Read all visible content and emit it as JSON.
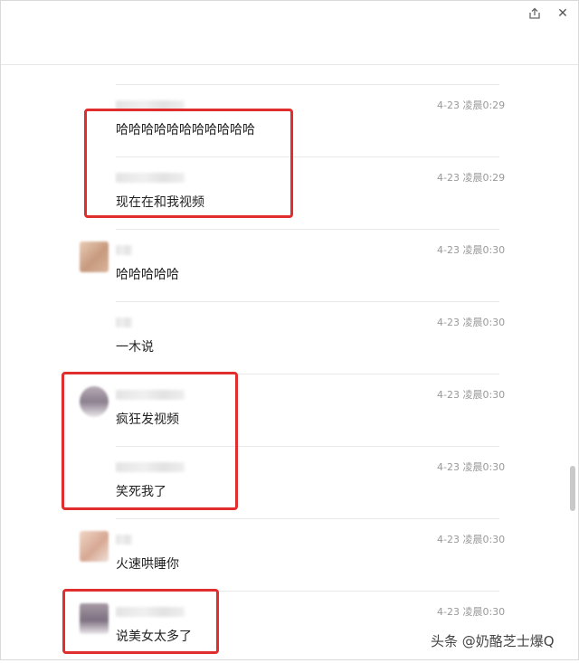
{
  "window": {
    "share_icon": "share-icon",
    "close_icon": "close-icon",
    "close_glyph": "✕"
  },
  "messages": [
    {
      "time": "4-23 凌晨0:29",
      "text": "哈哈哈哈哈哈哈哈哈哈哈",
      "avatar": false
    },
    {
      "time": "4-23 凌晨0:29",
      "text": "现在在和我视频",
      "avatar": false
    },
    {
      "time": "4-23 凌晨0:30",
      "text": "哈哈哈哈哈",
      "avatar": true
    },
    {
      "time": "4-23 凌晨0:30",
      "text": "一木说",
      "avatar": false
    },
    {
      "time": "4-23 凌晨0:30",
      "text": "疯狂发视频",
      "avatar": true
    },
    {
      "time": "4-23 凌晨0:30",
      "text": "笑死我了",
      "avatar": false
    },
    {
      "time": "4-23 凌晨0:30",
      "text": "火速哄睡你",
      "avatar": true
    },
    {
      "time": "4-23 凌晨0:30",
      "text": "说美女太多了",
      "avatar": true
    }
  ],
  "colors": {
    "highlight": "#e02d2d",
    "time": "#999999",
    "separator": "#e8e8e8"
  },
  "watermark": "头条 @奶酪芝士爆Q"
}
